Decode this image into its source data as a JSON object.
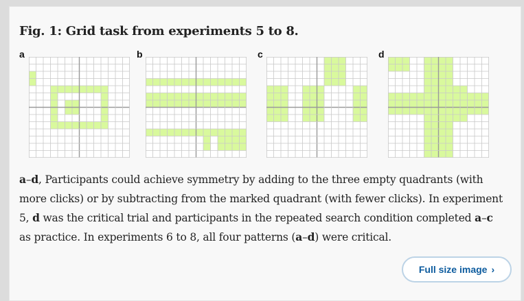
{
  "figure": {
    "title": "Fig. 1: Grid task from experiments 5 to 8.",
    "colors": {
      "filled": "#d9f99d",
      "line": "#c8c8c8",
      "axis": "#9a9a9a"
    },
    "grid_size": 14,
    "panels": [
      {
        "label": "a",
        "filled_rows": [
          [],
          [],
          [
            0
          ],
          [
            0
          ],
          [
            3,
            4,
            5,
            6,
            7,
            8,
            9,
            10
          ],
          [
            3,
            10
          ],
          [
            3,
            5,
            6,
            10
          ],
          [
            3,
            5,
            6,
            10
          ],
          [
            3,
            10
          ],
          [
            3,
            4,
            5,
            6,
            7,
            8,
            9,
            10
          ],
          [],
          [],
          [],
          []
        ]
      },
      {
        "label": "b",
        "filled_rows": [
          [],
          [],
          [],
          [
            0,
            1,
            2,
            3,
            4,
            5,
            6,
            7,
            8,
            9,
            10,
            11,
            12,
            13
          ],
          [],
          [
            0,
            1,
            2,
            3,
            4,
            5,
            6,
            7,
            8,
            9,
            10,
            11,
            12,
            13
          ],
          [
            0,
            1,
            2,
            3,
            4,
            5,
            6,
            7,
            8,
            9,
            10,
            11,
            12,
            13
          ],
          [],
          [],
          [],
          [
            0,
            1,
            2,
            3,
            4,
            5,
            6,
            7,
            8,
            9,
            10,
            11,
            12,
            13
          ],
          [
            8,
            10,
            11,
            12,
            13
          ],
          [
            8,
            10,
            11,
            12,
            13
          ],
          []
        ]
      },
      {
        "label": "c",
        "filled_rows": [
          [
            8,
            9,
            10
          ],
          [
            8,
            9,
            10
          ],
          [
            8,
            9,
            10
          ],
          [
            8,
            9,
            10
          ],
          [
            0,
            1,
            2,
            5,
            6,
            7,
            12,
            13
          ],
          [
            0,
            1,
            2,
            5,
            6,
            7,
            12,
            13
          ],
          [
            0,
            1,
            2,
            5,
            6,
            7,
            12,
            13
          ],
          [
            0,
            1,
            2,
            5,
            6,
            7,
            12,
            13
          ],
          [
            0,
            1,
            2,
            5,
            6,
            7,
            12,
            13
          ],
          [],
          [],
          [],
          [],
          []
        ]
      },
      {
        "label": "d",
        "filled_rows": [
          [
            0,
            1,
            2,
            5,
            6,
            7,
            8
          ],
          [
            0,
            1,
            2,
            5,
            6,
            7,
            8
          ],
          [
            5,
            6,
            7,
            8
          ],
          [
            5,
            6,
            7,
            8
          ],
          [
            5,
            6,
            7,
            8,
            9,
            10
          ],
          [
            0,
            1,
            2,
            3,
            4,
            5,
            6,
            7,
            8,
            9,
            10,
            11,
            12,
            13
          ],
          [
            0,
            1,
            2,
            3,
            4,
            5,
            6,
            7,
            8,
            9,
            10,
            11,
            12,
            13
          ],
          [
            0,
            1,
            2,
            3,
            4,
            5,
            6,
            7,
            8,
            9,
            10,
            11,
            12,
            13
          ],
          [
            5,
            6,
            7,
            8,
            9,
            10
          ],
          [
            5,
            6,
            7,
            8
          ],
          [
            5,
            6,
            7,
            8
          ],
          [
            5,
            6,
            7,
            8
          ],
          [
            5,
            6,
            7,
            8
          ],
          [
            5,
            6,
            7,
            8
          ]
        ]
      }
    ],
    "caption": [
      {
        "text": "a",
        "bold": true
      },
      {
        "text": "–",
        "bold": false
      },
      {
        "text": "d",
        "bold": true
      },
      {
        "text": ", Participants could achieve symmetry by adding to the three empty quadrants (with more clicks) or by subtracting from the marked quadrant (with fewer clicks). In experiment 5, ",
        "bold": false
      },
      {
        "text": "d",
        "bold": true
      },
      {
        "text": " was the critical trial and participants in the repeated search condition completed ",
        "bold": false
      },
      {
        "text": "a",
        "bold": true
      },
      {
        "text": "–",
        "bold": false
      },
      {
        "text": "c",
        "bold": true
      },
      {
        "text": " as practice. In experiments 6 to 8, all four patterns (",
        "bold": false
      },
      {
        "text": "a",
        "bold": true
      },
      {
        "text": "–",
        "bold": false
      },
      {
        "text": "d",
        "bold": true
      },
      {
        "text": ") were critical.",
        "bold": false
      }
    ]
  },
  "actions": {
    "full_size_label": "Full size image",
    "chevron_icon": "chevron-right-icon"
  }
}
